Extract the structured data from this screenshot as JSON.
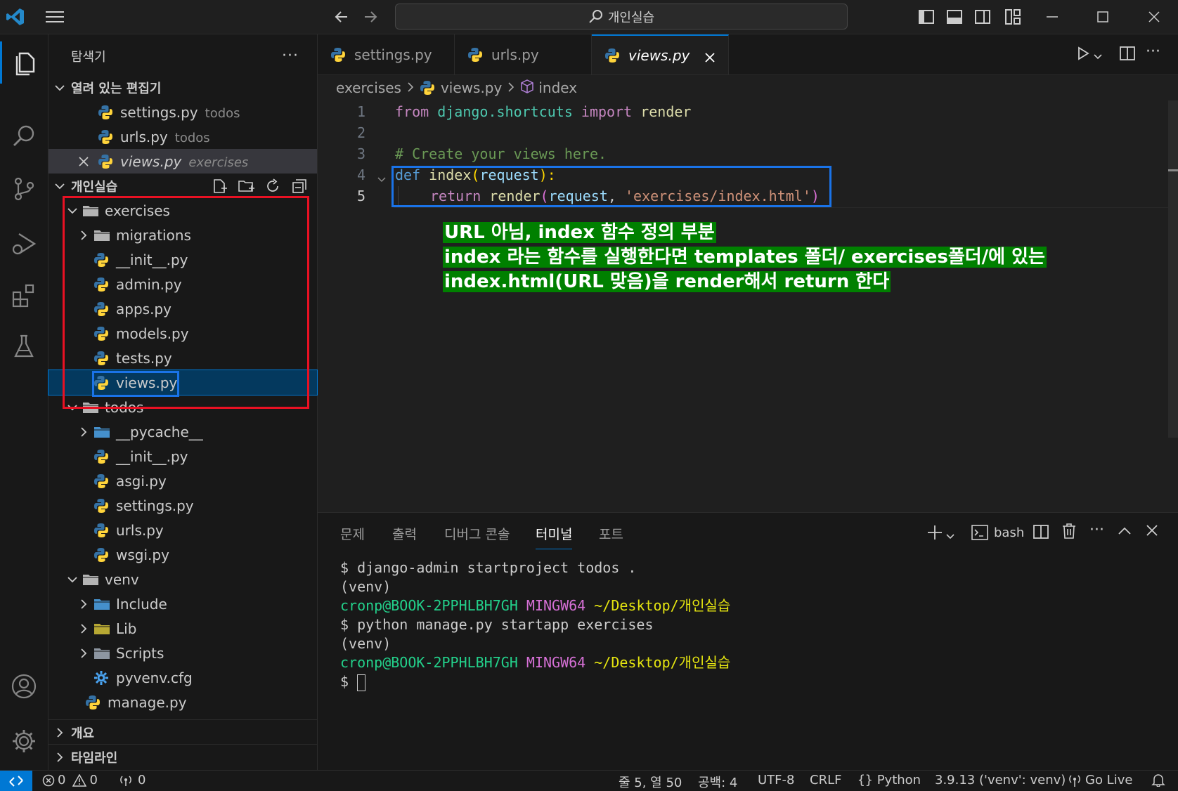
{
  "titlebar": {
    "search_text": "개인실습"
  },
  "sidebar": {
    "title": "탐색기",
    "open_editors": {
      "header": "열려 있는 편집기",
      "items": [
        {
          "name": "settings.py",
          "desc": "todos"
        },
        {
          "name": "urls.py",
          "desc": "todos"
        },
        {
          "name": "views.py",
          "desc": "exercises"
        }
      ]
    },
    "workspace": {
      "header": "개인실습",
      "tree": [
        "exercises",
        "migrations",
        "__init__.py",
        "admin.py",
        "apps.py",
        "models.py",
        "tests.py",
        "views.py",
        "todos",
        "__pycache__",
        "__init__.py",
        "asgi.py",
        "settings.py",
        "urls.py",
        "wsgi.py",
        "venv",
        "Include",
        "Lib",
        "Scripts",
        "pyvenv.cfg",
        "manage.py"
      ]
    },
    "outline": "개요",
    "timeline": "타임라인"
  },
  "tabs": [
    {
      "label": "settings.py"
    },
    {
      "label": "urls.py"
    },
    {
      "label": "views.py"
    }
  ],
  "breadcrumb": {
    "folder": "exercises",
    "file": "views.py",
    "symbol": "index"
  },
  "code": {
    "line_numbers": [
      "1",
      "2",
      "3",
      "4",
      "5"
    ],
    "l1": {
      "kw1": "from",
      "mod": "django.shortcuts",
      "kw2": "import",
      "name": "render"
    },
    "l3": {
      "comment": "# Create your views here."
    },
    "l4": {
      "kw": "def",
      "fn": "index",
      "open": "(",
      "param": "request",
      "close": "):"
    },
    "l5": {
      "kw": "return",
      "fn": "render",
      "open": "(",
      "arg": "request",
      "comma": ", ",
      "str": "'exercises/index.html'",
      "close": ")"
    }
  },
  "annotation": {
    "line1": "URL 아님, index 함수 정의 부분",
    "line2": "index 라는 함수를 실행한다면 templates 폴더/ exercises폴더/에 있는",
    "line3": "index.html(URL 맞음)을 render해서 return 한다"
  },
  "panel": {
    "tabs": [
      "문제",
      "출력",
      "디버그 콘솔",
      "터미널",
      "포트"
    ],
    "shell": "bash",
    "terminal": {
      "l1": "$ django-admin startproject todos .",
      "l2": "(venv)",
      "user": "cronp@BOOK-2PPHLBH7GH",
      "env": "MINGW64",
      "path": "~/Desktop/개인실습",
      "l4": "$ python manage.py startapp exercises",
      "l5": "(venv)",
      "prompt": "$"
    }
  },
  "statusbar": {
    "errors": "0",
    "warnings": "0",
    "ports": "0",
    "position": "줄 5, 열 50",
    "spaces": "공백: 4",
    "encoding": "UTF-8",
    "eol": "CRLF",
    "language": "Python",
    "interpreter": "3.9.13 ('venv': venv)",
    "golive": "Go Live"
  },
  "colors": {
    "accent": "#0078d4",
    "annotation_red": "#e81123",
    "annotation_blue": "#1a73e8",
    "annotation_green": "#008000"
  }
}
